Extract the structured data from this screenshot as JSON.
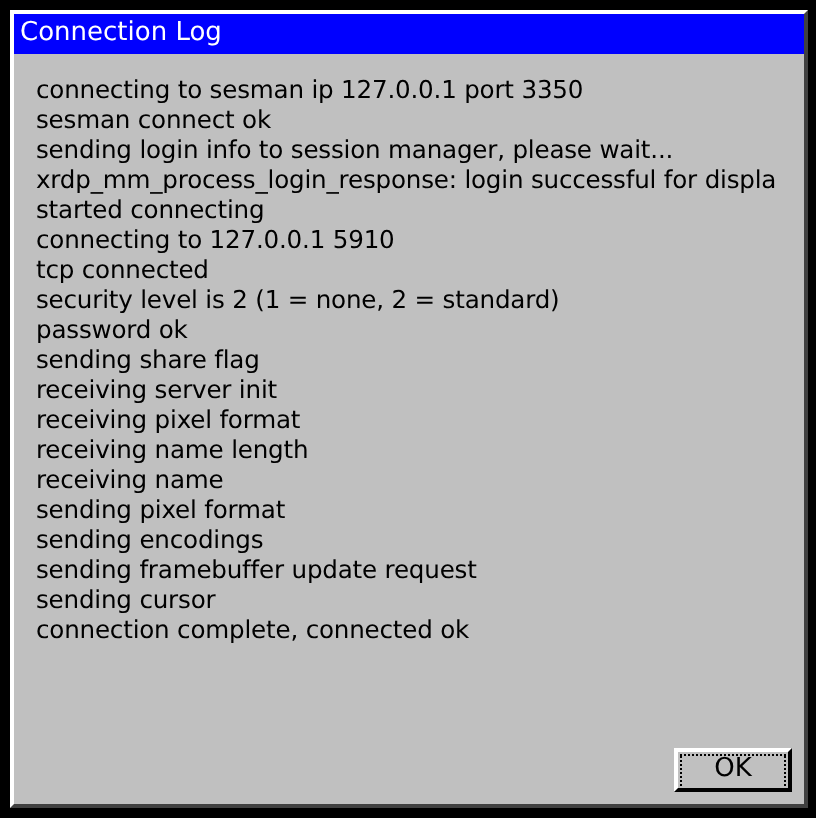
{
  "window": {
    "title": "Connection Log"
  },
  "log_lines": [
    "connecting to sesman ip 127.0.0.1 port 3350",
    "sesman connect ok",
    "sending login info to session manager, please wait...",
    "xrdp_mm_process_login_response: login successful for displa",
    "started connecting",
    "connecting to 127.0.0.1 5910",
    "tcp connected",
    "security level is 2 (1 = none, 2 = standard)",
    "password ok",
    "sending share flag",
    "receiving server init",
    "receiving pixel format",
    "receiving name length",
    "receiving name",
    "sending pixel format",
    "sending encodings",
    "sending framebuffer update request",
    "sending cursor",
    "connection complete, connected ok"
  ],
  "buttons": [
    {
      "label": "OK",
      "focused": true
    }
  ]
}
